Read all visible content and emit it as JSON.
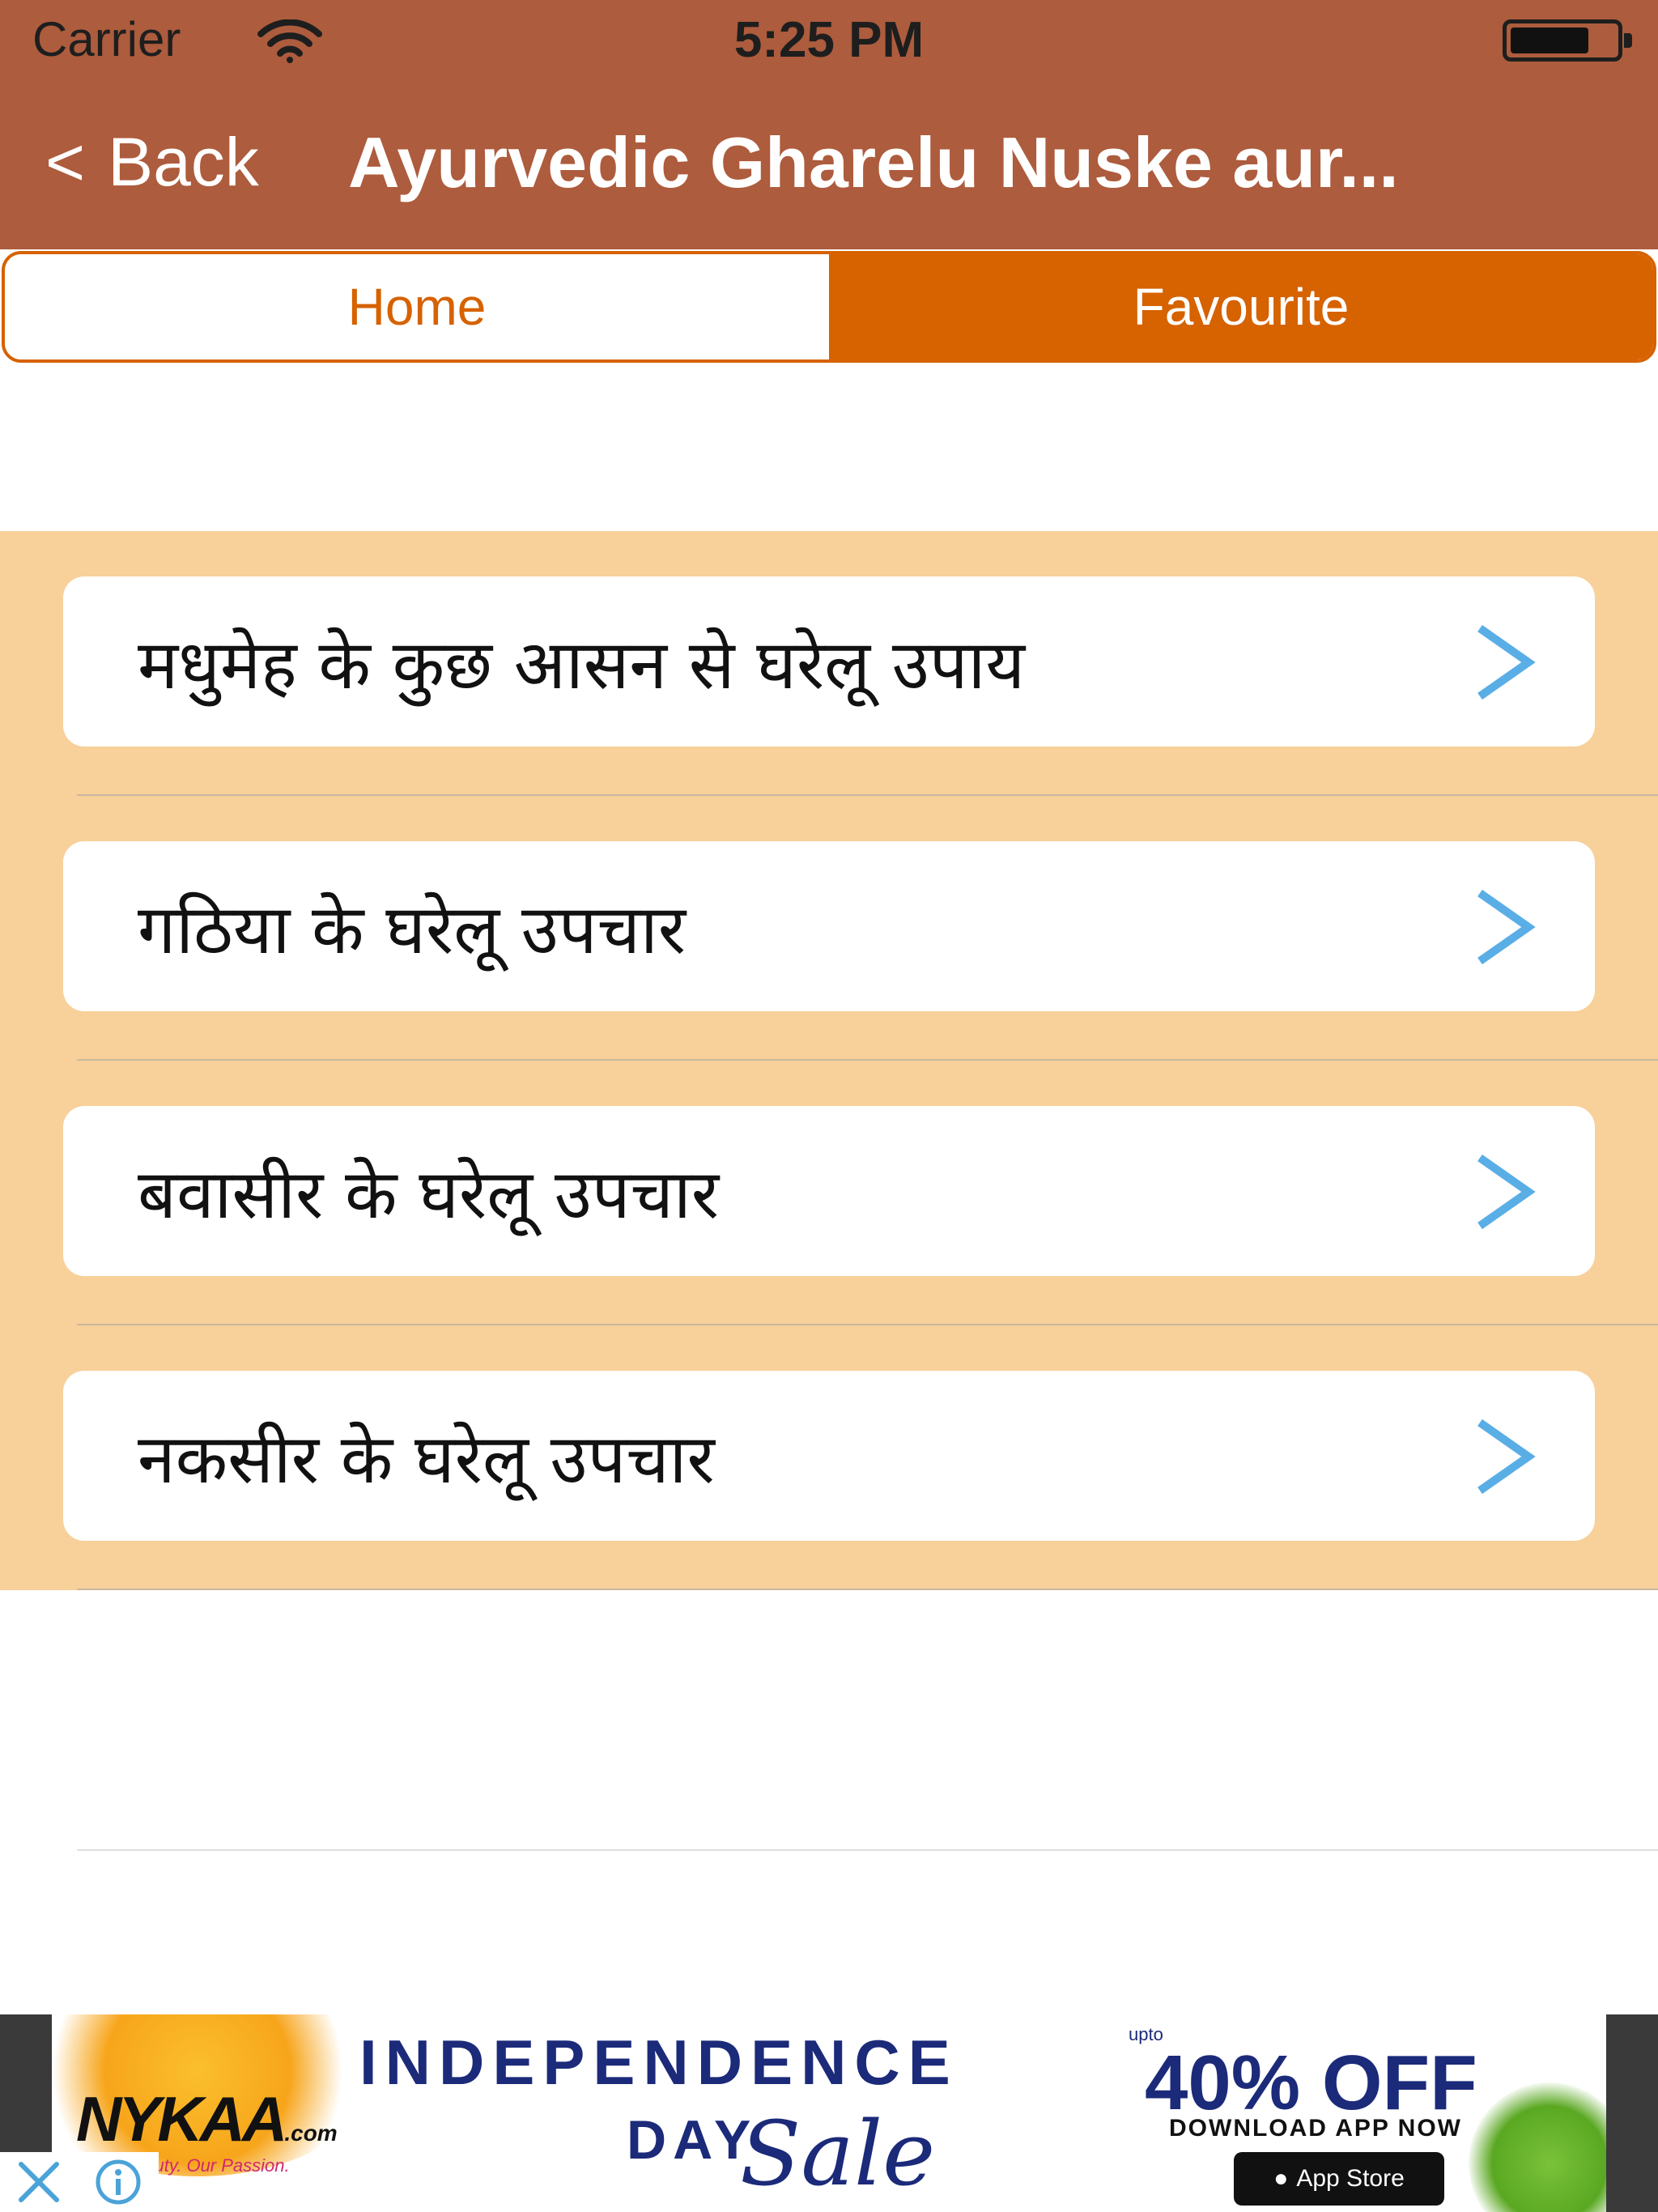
{
  "status_bar": {
    "carrier": "Carrier",
    "time": "5:25 PM",
    "battery_level": 0.75
  },
  "nav": {
    "back_label": "Back",
    "title": "Ayurvedic Gharelu Nuske aur..."
  },
  "segments": [
    {
      "label": "Home",
      "selected": false
    },
    {
      "label": "Favourite",
      "selected": true
    }
  ],
  "list": {
    "items": [
      {
        "label": "मधुमेह के कुछ आसन से घरेलू उपाय"
      },
      {
        "label": "गठिया के घरेलू उपचार"
      },
      {
        "label": "बवासीर के घरेलू उपचार"
      },
      {
        "label": "नकसीर के घरेलू उपचार"
      }
    ]
  },
  "ad": {
    "brand": "NYKAA",
    "brand_suffix": ".com",
    "tagline": "Your Beauty. Our Passion.",
    "headline": "INDEPENDENCE",
    "headline_day": "DAY",
    "headline_sale": "Sale",
    "upto": "upto",
    "offer": "40% OFF",
    "download": "DOWNLOAD APP NOW",
    "store": "App Store"
  },
  "colors": {
    "nav_bg": "#ad5c3d",
    "accent": "#d66200",
    "list_bg": "#f8d09a",
    "chevron": "#5aaee6"
  },
  "icons": [
    "wifi-icon",
    "battery-icon",
    "back-chevron-icon",
    "disclosure-chevron-icon",
    "ad-close-icon",
    "ad-info-icon"
  ]
}
